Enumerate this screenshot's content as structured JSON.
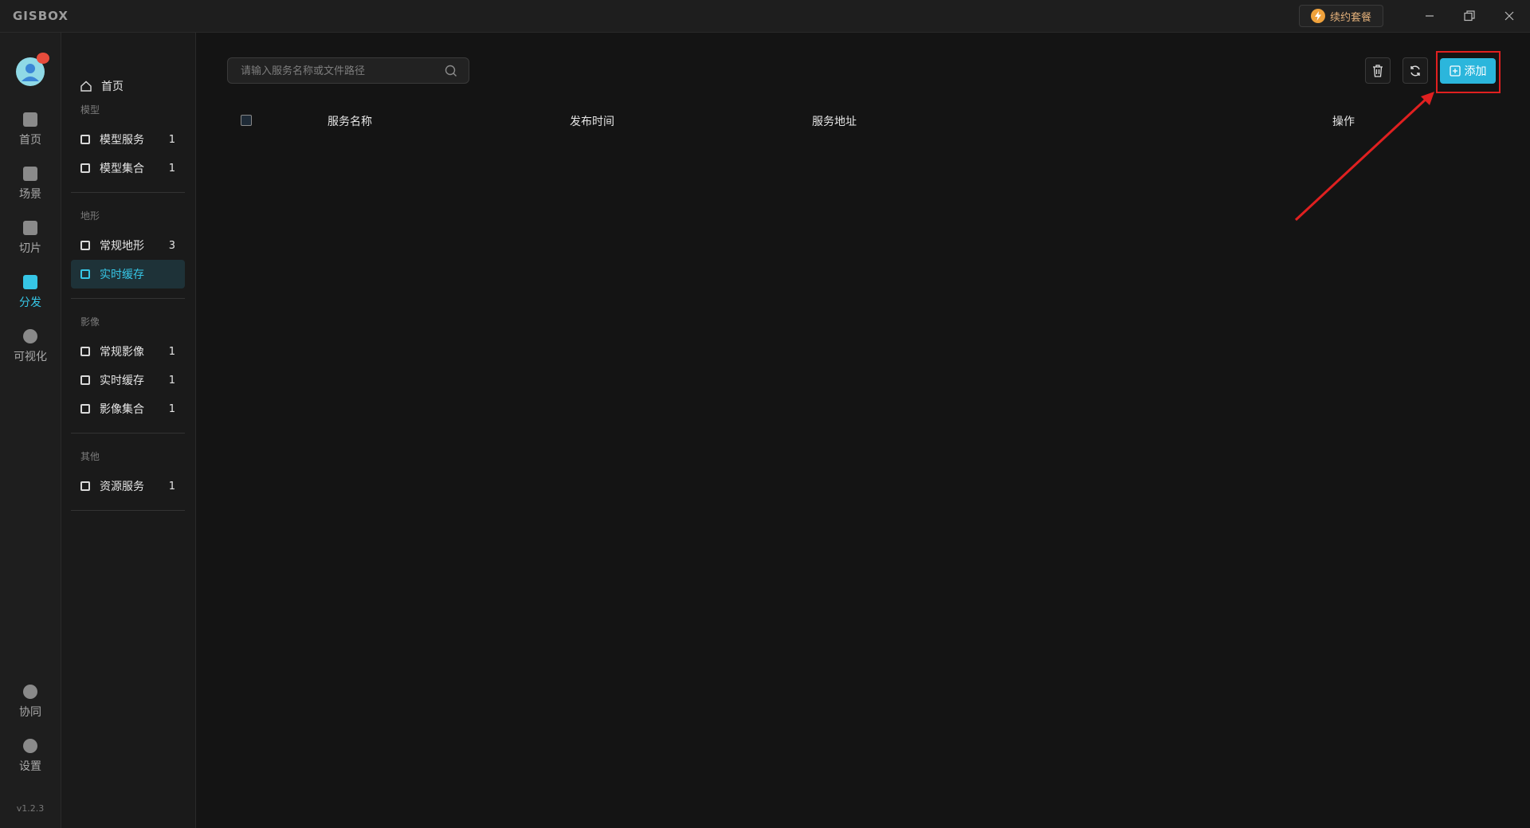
{
  "app": {
    "logo_text": "GISBOX",
    "renew_label": "续约套餐"
  },
  "rail": {
    "items": [
      {
        "label": "首页",
        "icon": "home-icon"
      },
      {
        "label": "场景",
        "icon": "scene-icon"
      },
      {
        "label": "切片",
        "icon": "tile-icon"
      },
      {
        "label": "分发",
        "icon": "distribute-icon",
        "active": true
      },
      {
        "label": "可视化",
        "icon": "visualization-icon"
      }
    ],
    "bottom_items": [
      {
        "label": "协同",
        "icon": "collaboration-icon"
      },
      {
        "label": "设置",
        "icon": "settings-icon"
      }
    ],
    "version": "v1.2.3"
  },
  "sidebar": {
    "home_label": "首页",
    "sections": [
      {
        "title": "模型",
        "items": [
          {
            "label": "模型服务",
            "count": "1"
          },
          {
            "label": "模型集合",
            "count": "1"
          }
        ]
      },
      {
        "title": "地形",
        "items": [
          {
            "label": "常规地形",
            "count": "3"
          },
          {
            "label": "实时缓存",
            "count": "",
            "active": true
          }
        ]
      },
      {
        "title": "影像",
        "items": [
          {
            "label": "常规影像",
            "count": "1"
          },
          {
            "label": "实时缓存",
            "count": "1"
          },
          {
            "label": "影像集合",
            "count": "1"
          }
        ]
      },
      {
        "title": "其他",
        "items": [
          {
            "label": "资源服务",
            "count": "1"
          }
        ]
      }
    ]
  },
  "main": {
    "search_placeholder": "请输入服务名称或文件路径",
    "add_label": "添加",
    "columns": [
      "服务名称",
      "发布时间",
      "服务地址",
      "操作"
    ]
  },
  "colors": {
    "accent": "#2bb6dc",
    "highlight": "#e02020",
    "background": "#141414"
  }
}
